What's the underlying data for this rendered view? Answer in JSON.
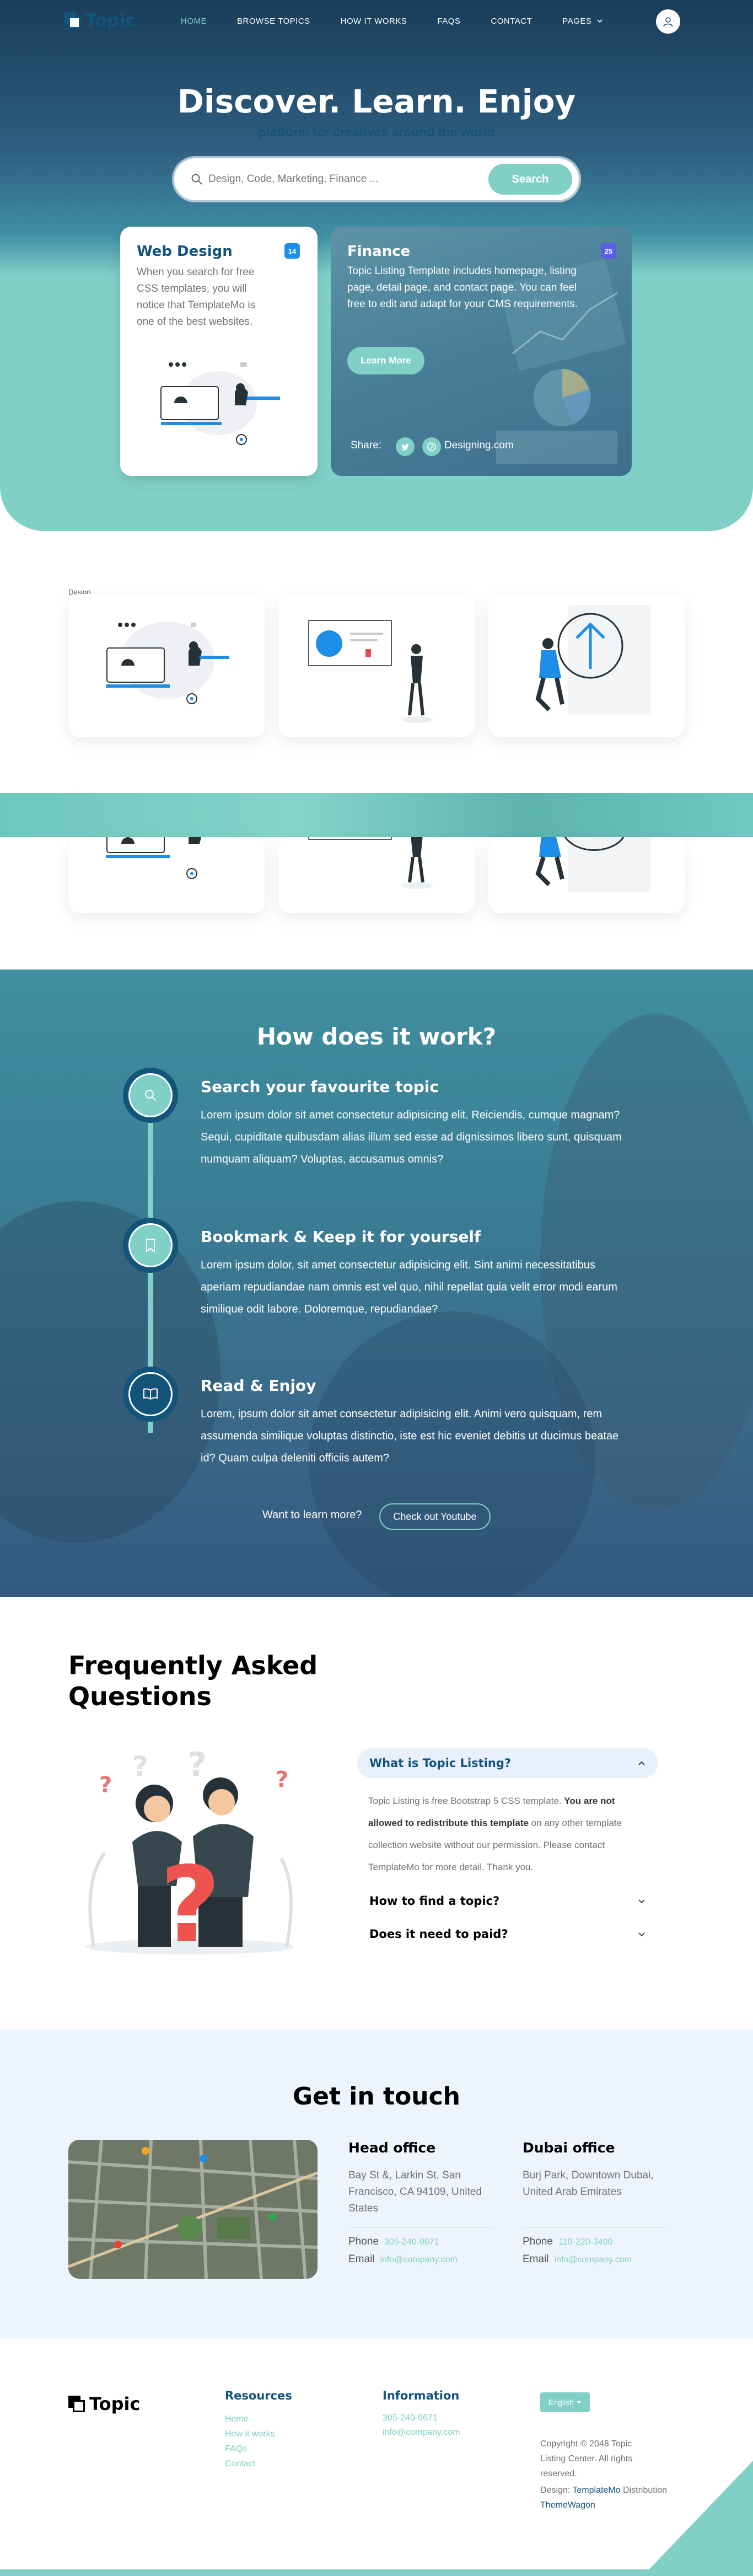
{
  "nav": {
    "brand": "Topic",
    "links": [
      "HOME",
      "BROWSE TOPICS",
      "HOW IT WORKS",
      "FAQS",
      "CONTACT",
      "PAGES"
    ],
    "active": "HOME"
  },
  "hero": {
    "title": "Discover. Learn. Enjoy",
    "subtitle": "platform for creatives around the world",
    "search_placeholder": "Design, Code, Marketing, Finance ...",
    "search_button": "Search"
  },
  "featured": {
    "web_design": {
      "title": "Web Design",
      "badge": "14",
      "text": "When you search for free CSS templates, you will notice that TemplateMo is one of the best websites."
    },
    "finance": {
      "title": "Finance",
      "badge": "25",
      "text": "Topic Listing Template includes homepage, listing page, detail page, and contact page. You can feel free to edit and adapt for your CMS requirements.",
      "button": "Learn More",
      "share_label": "Share:",
      "author": "Designing.com"
    }
  },
  "browse": {
    "tab_label": "Design"
  },
  "how": {
    "title": "How does it work?",
    "steps": [
      {
        "title": "Search your favourite topic",
        "text": "Lorem ipsum dolor sit amet consectetur adipisicing elit. Reiciendis, cumque magnam? Sequi, cupiditate quibusdam alias illum sed esse ad dignissimos libero sunt, quisquam numquam aliquam? Voluptas, accusamus omnis?"
      },
      {
        "title": "Bookmark & Keep it for yourself",
        "text": "Lorem ipsum dolor, sit amet consectetur adipisicing elit. Sint animi necessitatibus aperiam repudiandae nam omnis est vel quo, nihil repellat quia velit error modi earum similique odit labore. Doloremque, repudiandae?"
      },
      {
        "title": "Read & Enjoy",
        "text": "Lorem, ipsum dolor sit amet consectetur adipisicing elit. Animi vero quisquam, rem assumenda similique voluptas distinctio, iste est hic eveniet debitis ut ducimus beatae id? Quam culpa deleniti officiis autem?"
      }
    ],
    "want_text": "Want to learn more?",
    "youtube_button": "Check out Youtube"
  },
  "faq": {
    "title": "Frequently Asked Questions",
    "items": [
      {
        "question": "What is Topic Listing?",
        "answer_pre": "Topic Listing is free Bootstrap 5 CSS template.",
        "answer_bold": "You are not allowed to redistribute this template",
        "answer_post": "on any other template collection website without our permission. Please contact TemplateMo for more detail. Thank you."
      },
      {
        "question": "How to find a topic?"
      },
      {
        "question": "Does it need to paid?"
      }
    ]
  },
  "contact": {
    "title": "Get in touch",
    "offices": [
      {
        "name": "Head office",
        "address": "Bay St &, Larkin St, San Francisco, CA 94109, United States",
        "phone_label": "Phone",
        "phone": "305-240-9671",
        "email_label": "Email",
        "email": "info@company.com"
      },
      {
        "name": "Dubai office",
        "address": "Burj Park, Downtown Dubai, United Arab Emirates",
        "phone_label": "Phone",
        "phone": "110-220-3400",
        "email_label": "Email",
        "email": "info@company.com"
      }
    ]
  },
  "footer": {
    "brand": "Topic",
    "resources": {
      "title": "Resources",
      "links": [
        "Home",
        "How it works",
        "FAQs",
        "Contact"
      ]
    },
    "information": {
      "title": "Information",
      "phone": "305-240-9671",
      "email": "info@company.com"
    },
    "language": "English",
    "copyright": "Copyright © 2048 Topic Listing Center. All rights reserved.",
    "design_prefix": "Design:",
    "design_by": "TemplateMo",
    "distribution_prefix": "Distribution",
    "distribution_by": "ThemeWagon"
  },
  "colors": {
    "primary": "#13547a",
    "secondary": "#80d0c7",
    "badge_blue": "#1d8de8",
    "badge_purple": "#5a5ee0"
  }
}
